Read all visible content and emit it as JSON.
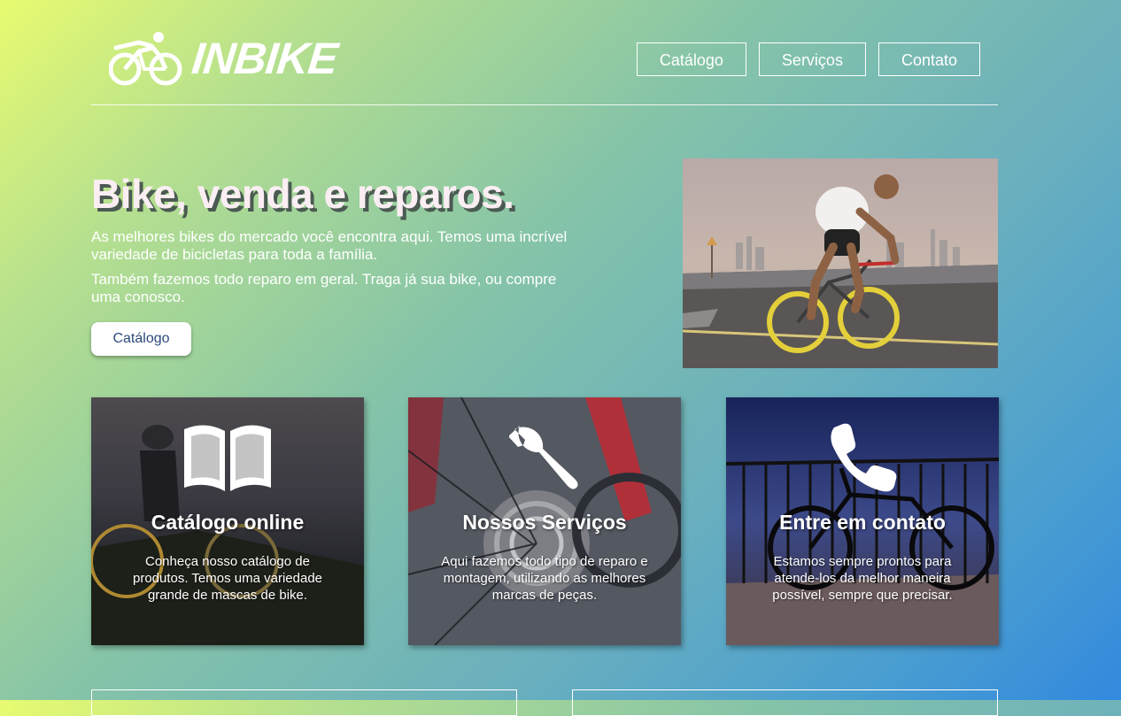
{
  "brand": {
    "name": "INBIKE"
  },
  "nav": {
    "items": [
      "Catálogo",
      "Serviços",
      "Contato"
    ]
  },
  "hero": {
    "title": "Bike, venda e reparos.",
    "paragraph1": "As melhores bikes do mercado você encontra aqui. Temos uma incrível variedade de bicicletas para toda a família.",
    "paragraph2": "Também fazemos todo reparo em geral. Traga já sua bike, ou compre uma conosco.",
    "button": "Catálogo"
  },
  "cards": [
    {
      "icon": "book-icon",
      "title": "Catálogo online",
      "text": "Conheça nosso catálogo de produtos. Temos uma variedade grande de mascas de bike."
    },
    {
      "icon": "wrench-icon",
      "title": "Nossos Serviços",
      "text": "Aqui fazemos todo tipo de reparo e montagem, utilizando as melhores marcas de peças."
    },
    {
      "icon": "phone-icon",
      "title": "Entre em contato",
      "text": "Estamos sempre prontos para atende-los da melhor maneira possível, sempre que precisar."
    }
  ],
  "colors": {
    "button_text": "#2c4a7c",
    "title_text": "#fbeef3"
  }
}
